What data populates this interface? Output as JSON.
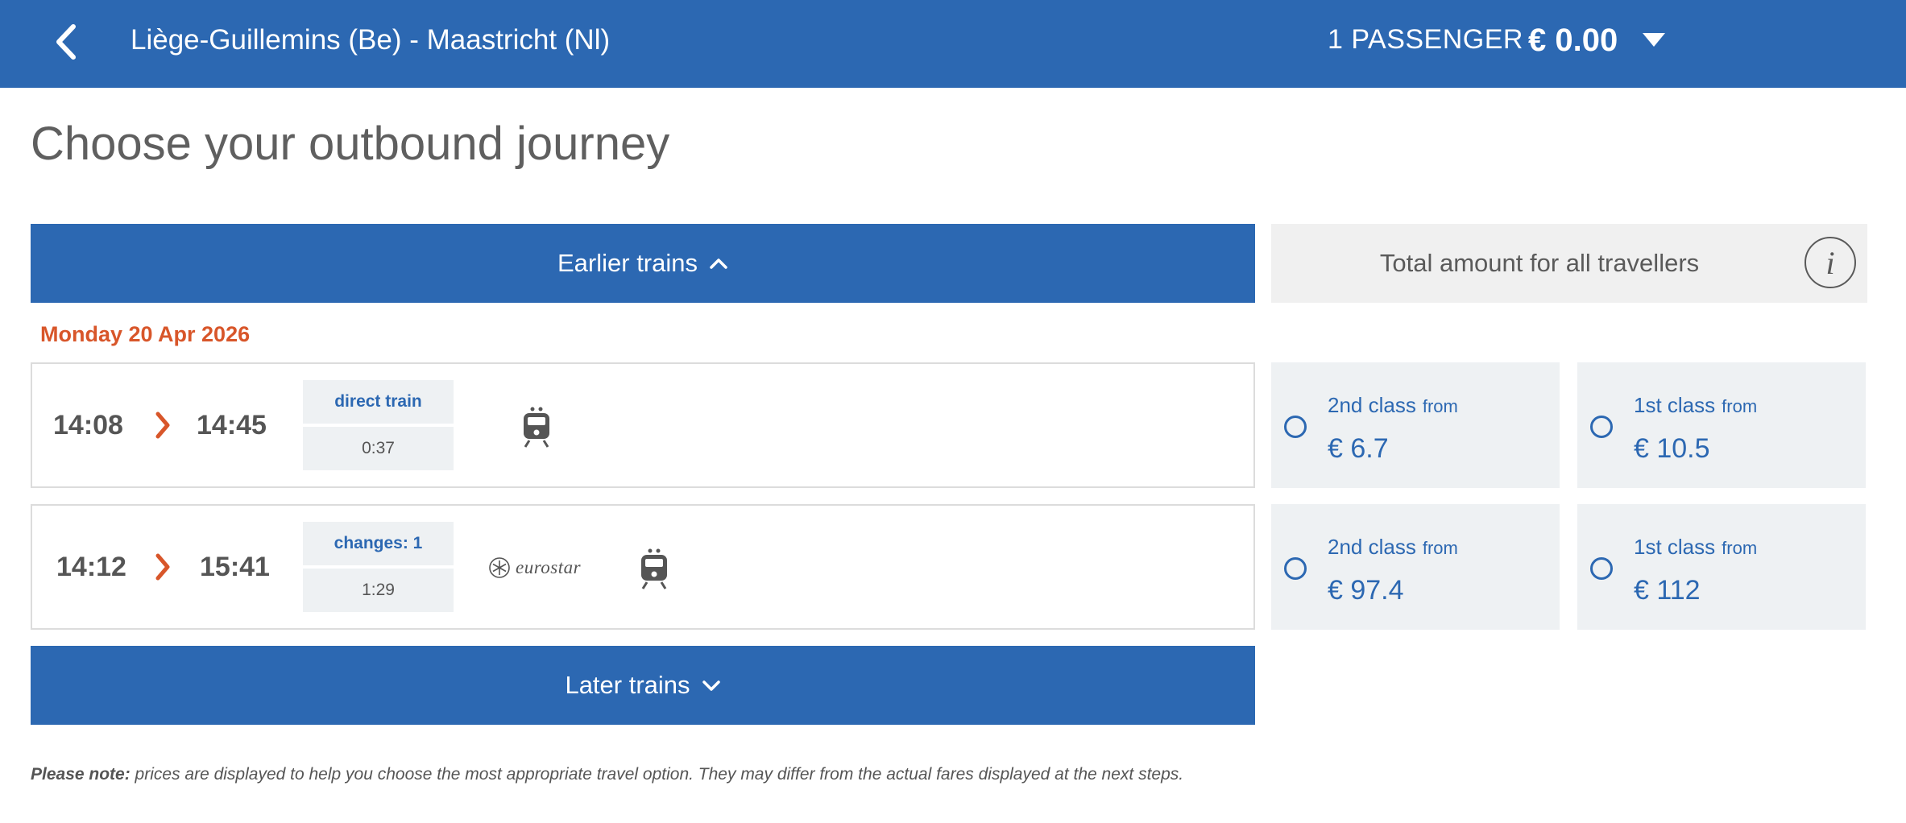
{
  "header": {
    "route": "Liège-Guillemins (Be) - Maastricht (Nl)",
    "passengers": "1 PASSENGER",
    "total": "€ 0.00"
  },
  "page_title": "Choose your outbound journey",
  "earlier_label": "Earlier trains",
  "later_label": "Later trains",
  "total_label": "Total amount for all travellers",
  "info_glyph": "i",
  "date": "Monday 20 Apr 2026",
  "journeys": [
    {
      "departure": "14:08",
      "arrival": "14:45",
      "type": "direct train",
      "duration": "0:37",
      "operators": [
        "train-icon"
      ],
      "fares": [
        {
          "class": "2nd class",
          "from": "from",
          "price": "€ 6.7"
        },
        {
          "class": "1st class",
          "from": "from",
          "price": "€ 10.5"
        }
      ]
    },
    {
      "departure": "14:12",
      "arrival": "15:41",
      "type": "changes: 1",
      "duration": "1:29",
      "operators": [
        "eurostar-logo",
        "train-icon"
      ],
      "eurostar_text": "eurostar",
      "fares": [
        {
          "class": "2nd class",
          "from": "from",
          "price": "€ 97.4"
        },
        {
          "class": "1st class",
          "from": "from",
          "price": "€ 112"
        }
      ]
    }
  ],
  "note": {
    "label": "Please note:",
    "text": " prices are displayed to help you choose the most appropriate travel option. They may differ from the actual fares displayed at the next steps."
  },
  "colors": {
    "brand_blue": "#2c68b2",
    "accent_orange": "#d8562a",
    "panel_grey": "#eef1f3"
  }
}
